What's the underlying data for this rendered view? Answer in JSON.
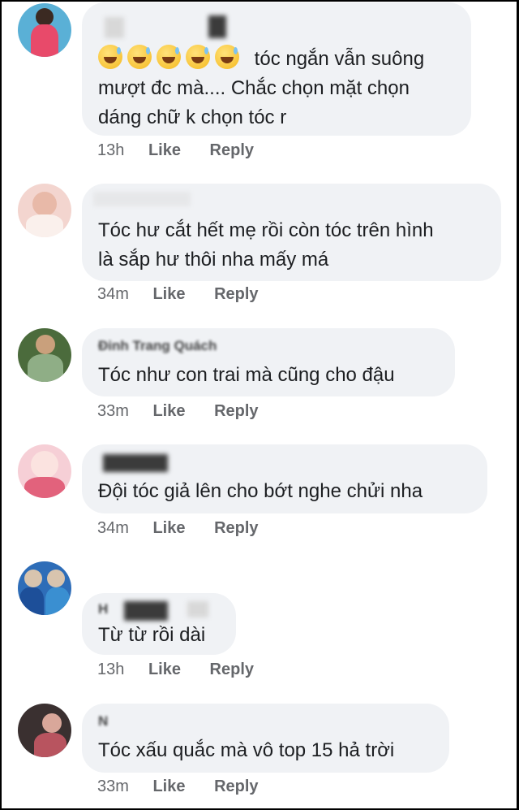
{
  "comments": [
    {
      "author": "",
      "emoji_count": 5,
      "text_lines": [
        "tóc ngắn vẫn suông",
        "mượt đc mà.... Chắc chọn mặt chọn",
        "dáng chữ k chọn tóc r"
      ],
      "time": "13h",
      "like": "Like",
      "reply": "Reply",
      "avatar_colors": [
        "#5ab0d6",
        "#e84a6a"
      ]
    },
    {
      "author": "",
      "text_lines": [
        "Tóc hư cắt hết mẹ rồi còn tóc trên hình",
        "là sắp hư thôi nha mấy má"
      ],
      "time": "34m",
      "like": "Like",
      "reply": "Reply",
      "avatar_colors": [
        "#f3d5cf",
        "#e8b9a8"
      ]
    },
    {
      "author": "Đinh Trang Quách",
      "text_lines": [
        "Tóc như con trai mà cũng cho đậu"
      ],
      "time": "33m",
      "like": "Like",
      "reply": "Reply",
      "avatar_colors": [
        "#4b6b3c",
        "#c9a07c"
      ]
    },
    {
      "author": "",
      "text_lines": [
        "Đội tóc giả lên cho bớt nghe chửi nha"
      ],
      "time": "34m",
      "like": "Like",
      "reply": "Reply",
      "avatar_colors": [
        "#f6cfd6",
        "#e2627c"
      ]
    },
    {
      "author": "H",
      "text_lines": [
        "Từ từ rồi dài"
      ],
      "time": "13h",
      "like": "Like",
      "reply": "Reply",
      "avatar_colors": [
        "#2e6db8",
        "#d8c4ae"
      ]
    },
    {
      "author": "N",
      "text_lines": [
        "Tóc xấu quắc mà vô top 15 hả trời"
      ],
      "time": "33m",
      "like": "Like",
      "reply": "Reply",
      "avatar_colors": [
        "#3a3030",
        "#d9a79a"
      ]
    }
  ]
}
